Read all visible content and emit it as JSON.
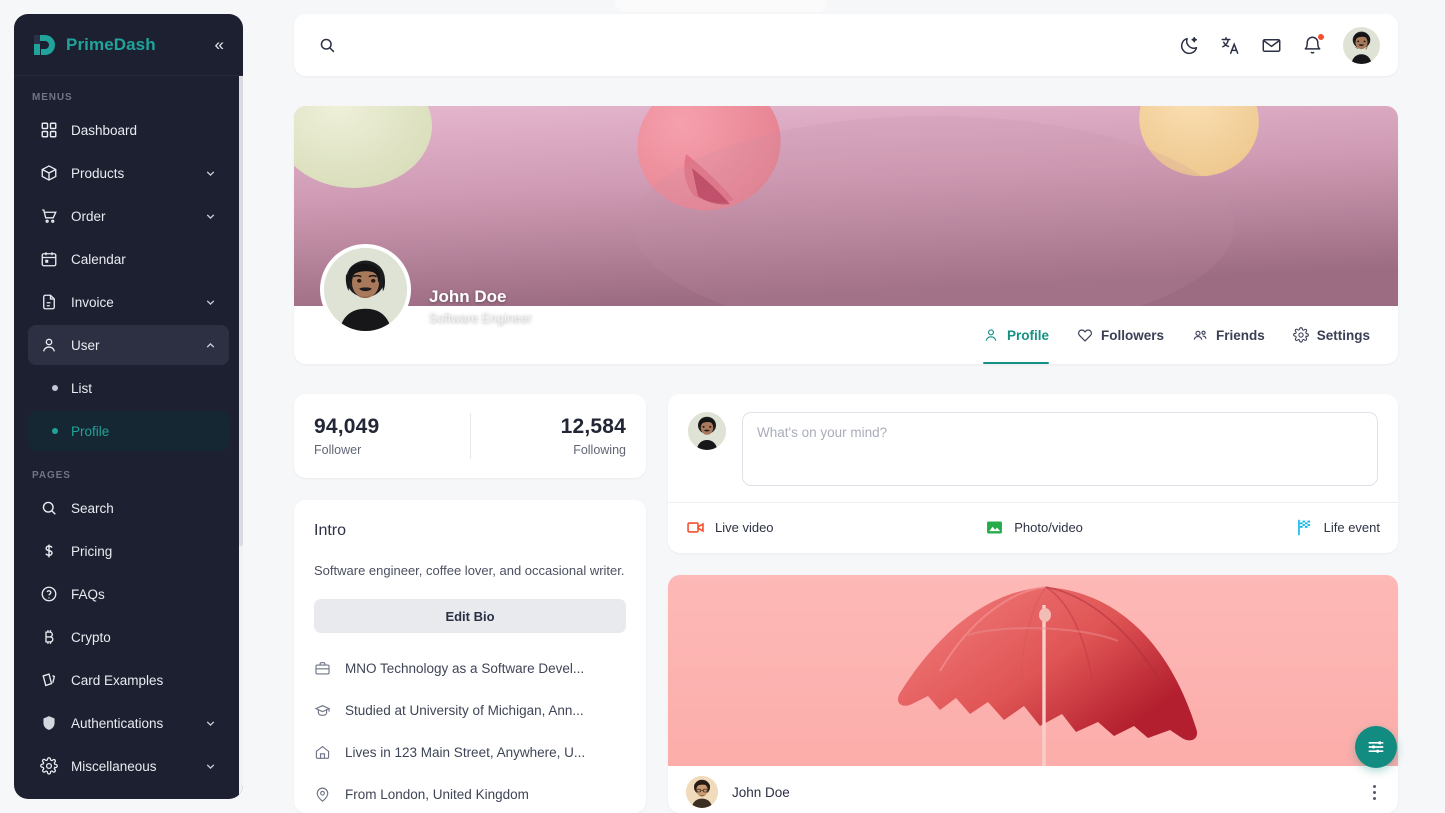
{
  "brand": {
    "name": "PrimeDash",
    "logo_icon": "prime-dash-logo",
    "collapse_icon": "chevron-double-left-icon"
  },
  "search": {
    "value": "",
    "placeholder": "",
    "icon": "search-icon"
  },
  "header": {
    "icons": [
      {
        "name": "dark-mode-icon",
        "label": "Dark mode"
      },
      {
        "name": "translate-icon",
        "label": "Language"
      },
      {
        "name": "mail-icon",
        "label": "Messages"
      },
      {
        "name": "bell-icon",
        "label": "Notifications",
        "has_badge": true
      }
    ],
    "avatar": "user-avatar"
  },
  "sidebar": {
    "sections": [
      {
        "label": "MENUS",
        "items": [
          {
            "label": "Dashboard",
            "icon": "grid-icon",
            "expandable": false
          },
          {
            "label": "Products",
            "icon": "box-icon",
            "expandable": true,
            "expanded": false
          },
          {
            "label": "Order",
            "icon": "cart-icon",
            "expandable": true,
            "expanded": false
          },
          {
            "label": "Calendar",
            "icon": "calendar-icon",
            "expandable": false
          },
          {
            "label": "Invoice",
            "icon": "document-icon",
            "expandable": true,
            "expanded": false
          },
          {
            "label": "User",
            "icon": "user-icon",
            "expandable": true,
            "expanded": true,
            "active": true
          }
        ],
        "sub_items": [
          {
            "label": "List",
            "current": false
          },
          {
            "label": "Profile",
            "current": true
          }
        ]
      },
      {
        "label": "PAGES",
        "items": [
          {
            "label": "Search",
            "icon": "search-icon",
            "expandable": false
          },
          {
            "label": "Pricing",
            "icon": "dollar-icon",
            "expandable": false
          },
          {
            "label": "FAQs",
            "icon": "question-circle-icon",
            "expandable": false
          },
          {
            "label": "Crypto",
            "icon": "bitcoin-icon",
            "expandable": false
          },
          {
            "label": "Card Examples",
            "icon": "cards-icon",
            "expandable": false
          },
          {
            "label": "Authentications",
            "icon": "shield-icon",
            "expandable": true,
            "expanded": false
          },
          {
            "label": "Miscellaneous",
            "icon": "gear-icon",
            "expandable": true,
            "expanded": false
          }
        ]
      }
    ]
  },
  "profile": {
    "name": "John Doe",
    "role": "Software Engineer",
    "cover_image": "pink-macaron-cover-photo",
    "avatar": "john-doe-avatar",
    "tabs": [
      {
        "label": "Profile",
        "icon": "user-icon",
        "active": true
      },
      {
        "label": "Followers",
        "icon": "heart-icon",
        "active": false
      },
      {
        "label": "Friends",
        "icon": "people-icon",
        "active": false
      },
      {
        "label": "Settings",
        "icon": "gear-icon",
        "active": false
      }
    ]
  },
  "stats": {
    "follower": {
      "value": "94,049",
      "label": "Follower"
    },
    "following": {
      "value": "12,584",
      "label": "Following"
    }
  },
  "intro": {
    "title": "Intro",
    "bio": "Software engineer, coffee lover, and occasional writer.",
    "edit_button": "Edit Bio",
    "items": [
      {
        "text": "MNO Technology as a Software Devel...",
        "icon": "briefcase-icon"
      },
      {
        "text": "Studied at University of Michigan, Ann...",
        "icon": "graduation-cap-icon"
      },
      {
        "text": "Lives in 123 Main Street, Anywhere, U...",
        "icon": "home-icon"
      },
      {
        "text": "From London, United Kingdom",
        "icon": "location-pin-icon"
      }
    ]
  },
  "composer": {
    "placeholder": "What's on your mind?",
    "value": "",
    "avatar": "john-doe-avatar",
    "actions": [
      {
        "label": "Live video",
        "icon": "video-camera-icon",
        "color": "#f4502e"
      },
      {
        "label": "Photo/video",
        "icon": "photo-icon",
        "color": "#26ab4b"
      },
      {
        "label": "Life event",
        "icon": "flag-icon",
        "color": "#0ab4e8"
      }
    ]
  },
  "post": {
    "image": "red-umbrella-on-pink-photo",
    "author": "John Doe",
    "avatar": "john-doe-avatar",
    "menu_icon": "kebab-menu-icon"
  },
  "fab": {
    "icon": "sliders-icon",
    "color": "#128b80"
  },
  "colors": {
    "accent": "#149084",
    "sidebar_bg": "#1d2030",
    "page_bg": "#f6f7f9",
    "notification": "#f4502e"
  }
}
